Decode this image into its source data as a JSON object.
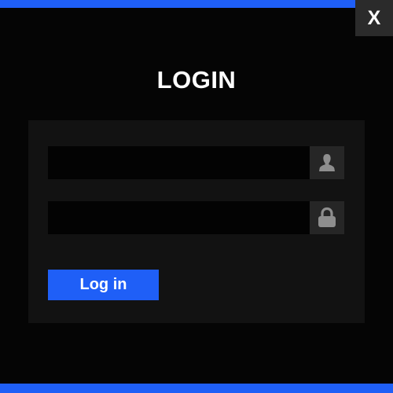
{
  "window": {
    "close_label": "X"
  },
  "login_form": {
    "title": "LOGIN",
    "username": {
      "value": "",
      "placeholder": "",
      "icon": "user-icon"
    },
    "password": {
      "value": "",
      "placeholder": "",
      "icon": "lock-icon"
    },
    "submit_label": "Log in"
  },
  "colors": {
    "accent": "#1f5ff7",
    "background": "#050505",
    "panel": "#121212",
    "field": "#030303",
    "icon_box": "#262626",
    "close_button": "#2b2b2b",
    "icon": "#8e8e8e"
  }
}
